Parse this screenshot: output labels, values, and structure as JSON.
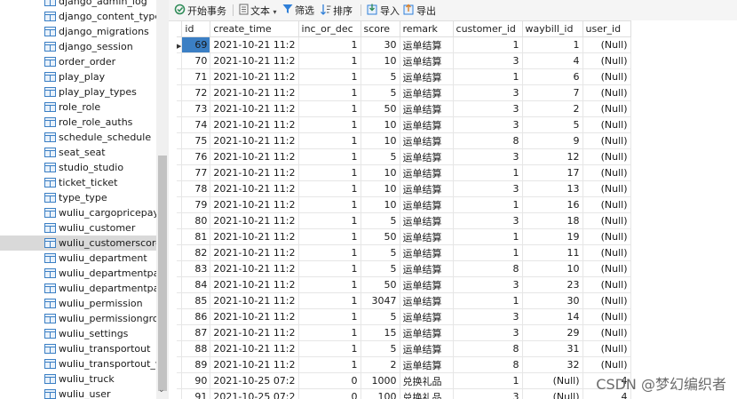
{
  "sidebar": {
    "items": [
      {
        "label": "django_admin_log"
      },
      {
        "label": "django_content_type"
      },
      {
        "label": "django_migrations"
      },
      {
        "label": "django_session"
      },
      {
        "label": "order_order"
      },
      {
        "label": "play_play"
      },
      {
        "label": "play_play_types"
      },
      {
        "label": "role_role"
      },
      {
        "label": "role_role_auths"
      },
      {
        "label": "schedule_schedule"
      },
      {
        "label": "seat_seat"
      },
      {
        "label": "studio_studio"
      },
      {
        "label": "ticket_ticket"
      },
      {
        "label": "type_type"
      },
      {
        "label": "wuliu_cargopricepayn"
      },
      {
        "label": "wuliu_customer"
      },
      {
        "label": "wuliu_customerscorelo"
      },
      {
        "label": "wuliu_department"
      },
      {
        "label": "wuliu_departmentpay"
      },
      {
        "label": "wuliu_departmentpay"
      },
      {
        "label": "wuliu_permission"
      },
      {
        "label": "wuliu_permissiongrou"
      },
      {
        "label": "wuliu_settings"
      },
      {
        "label": "wuliu_transportout"
      },
      {
        "label": "wuliu_transportout_w"
      },
      {
        "label": "wuliu_truck"
      },
      {
        "label": "wuliu_user"
      }
    ],
    "selected_index": 16
  },
  "toolbar": {
    "begin_transaction": "开始事务",
    "text": "文本",
    "filter": "筛选",
    "sort": "排序",
    "import": "导入",
    "export": "导出"
  },
  "grid": {
    "columns": [
      "id",
      "create_time",
      "inc_or_dec",
      "score",
      "remark",
      "customer_id",
      "waybill_id",
      "user_id"
    ],
    "rows": [
      {
        "id": "69",
        "create_time": "2021-10-21 11:2",
        "inc_or_dec": "1",
        "score": "30",
        "remark": "运单结算",
        "customer_id": "1",
        "waybill_id": "1",
        "user_id": "(Null)"
      },
      {
        "id": "70",
        "create_time": "2021-10-21 11:2",
        "inc_or_dec": "1",
        "score": "10",
        "remark": "运单结算",
        "customer_id": "3",
        "waybill_id": "4",
        "user_id": "(Null)"
      },
      {
        "id": "71",
        "create_time": "2021-10-21 11:2",
        "inc_or_dec": "1",
        "score": "5",
        "remark": "运单结算",
        "customer_id": "1",
        "waybill_id": "6",
        "user_id": "(Null)"
      },
      {
        "id": "72",
        "create_time": "2021-10-21 11:2",
        "inc_or_dec": "1",
        "score": "5",
        "remark": "运单结算",
        "customer_id": "3",
        "waybill_id": "7",
        "user_id": "(Null)"
      },
      {
        "id": "73",
        "create_time": "2021-10-21 11:2",
        "inc_or_dec": "1",
        "score": "50",
        "remark": "运单结算",
        "customer_id": "3",
        "waybill_id": "2",
        "user_id": "(Null)"
      },
      {
        "id": "74",
        "create_time": "2021-10-21 11:2",
        "inc_or_dec": "1",
        "score": "10",
        "remark": "运单结算",
        "customer_id": "3",
        "waybill_id": "5",
        "user_id": "(Null)"
      },
      {
        "id": "75",
        "create_time": "2021-10-21 11:2",
        "inc_or_dec": "1",
        "score": "10",
        "remark": "运单结算",
        "customer_id": "8",
        "waybill_id": "9",
        "user_id": "(Null)"
      },
      {
        "id": "76",
        "create_time": "2021-10-21 11:2",
        "inc_or_dec": "1",
        "score": "5",
        "remark": "运单结算",
        "customer_id": "3",
        "waybill_id": "12",
        "user_id": "(Null)"
      },
      {
        "id": "77",
        "create_time": "2021-10-21 11:2",
        "inc_or_dec": "1",
        "score": "10",
        "remark": "运单结算",
        "customer_id": "1",
        "waybill_id": "17",
        "user_id": "(Null)"
      },
      {
        "id": "78",
        "create_time": "2021-10-21 11:2",
        "inc_or_dec": "1",
        "score": "10",
        "remark": "运单结算",
        "customer_id": "3",
        "waybill_id": "13",
        "user_id": "(Null)"
      },
      {
        "id": "79",
        "create_time": "2021-10-21 11:2",
        "inc_or_dec": "1",
        "score": "10",
        "remark": "运单结算",
        "customer_id": "1",
        "waybill_id": "16",
        "user_id": "(Null)"
      },
      {
        "id": "80",
        "create_time": "2021-10-21 11:2",
        "inc_or_dec": "1",
        "score": "5",
        "remark": "运单结算",
        "customer_id": "3",
        "waybill_id": "18",
        "user_id": "(Null)"
      },
      {
        "id": "81",
        "create_time": "2021-10-21 11:2",
        "inc_or_dec": "1",
        "score": "50",
        "remark": "运单结算",
        "customer_id": "1",
        "waybill_id": "19",
        "user_id": "(Null)"
      },
      {
        "id": "82",
        "create_time": "2021-10-21 11:2",
        "inc_or_dec": "1",
        "score": "5",
        "remark": "运单结算",
        "customer_id": "1",
        "waybill_id": "11",
        "user_id": "(Null)"
      },
      {
        "id": "83",
        "create_time": "2021-10-21 11:2",
        "inc_or_dec": "1",
        "score": "5",
        "remark": "运单结算",
        "customer_id": "8",
        "waybill_id": "10",
        "user_id": "(Null)"
      },
      {
        "id": "84",
        "create_time": "2021-10-21 11:2",
        "inc_or_dec": "1",
        "score": "50",
        "remark": "运单结算",
        "customer_id": "3",
        "waybill_id": "23",
        "user_id": "(Null)"
      },
      {
        "id": "85",
        "create_time": "2021-10-21 11:2",
        "inc_or_dec": "1",
        "score": "3047",
        "remark": "运单结算",
        "customer_id": "1",
        "waybill_id": "30",
        "user_id": "(Null)"
      },
      {
        "id": "86",
        "create_time": "2021-10-21 11:2",
        "inc_or_dec": "1",
        "score": "5",
        "remark": "运单结算",
        "customer_id": "3",
        "waybill_id": "14",
        "user_id": "(Null)"
      },
      {
        "id": "87",
        "create_time": "2021-10-21 11:2",
        "inc_or_dec": "1",
        "score": "15",
        "remark": "运单结算",
        "customer_id": "3",
        "waybill_id": "29",
        "user_id": "(Null)"
      },
      {
        "id": "88",
        "create_time": "2021-10-21 11:2",
        "inc_or_dec": "1",
        "score": "5",
        "remark": "运单结算",
        "customer_id": "8",
        "waybill_id": "31",
        "user_id": "(Null)"
      },
      {
        "id": "89",
        "create_time": "2021-10-21 11:2",
        "inc_or_dec": "1",
        "score": "2",
        "remark": "运单结算",
        "customer_id": "8",
        "waybill_id": "32",
        "user_id": "(Null)"
      },
      {
        "id": "90",
        "create_time": "2021-10-25 07:2",
        "inc_or_dec": "0",
        "score": "1000",
        "remark": "兑换礼品",
        "customer_id": "1",
        "waybill_id": "(Null)",
        "user_id": "4"
      },
      {
        "id": "91",
        "create_time": "2021-10-25 07:2",
        "inc_or_dec": "0",
        "score": "100",
        "remark": "兑换礼品",
        "customer_id": "3",
        "waybill_id": "(Null)",
        "user_id": "4"
      }
    ]
  },
  "watermark": "CSDN @梦幻编织者",
  "colors": {
    "selection": "#3b7fc4",
    "null_text": "#b5b5b5",
    "sidebar_selected": "#d9d9d9"
  }
}
